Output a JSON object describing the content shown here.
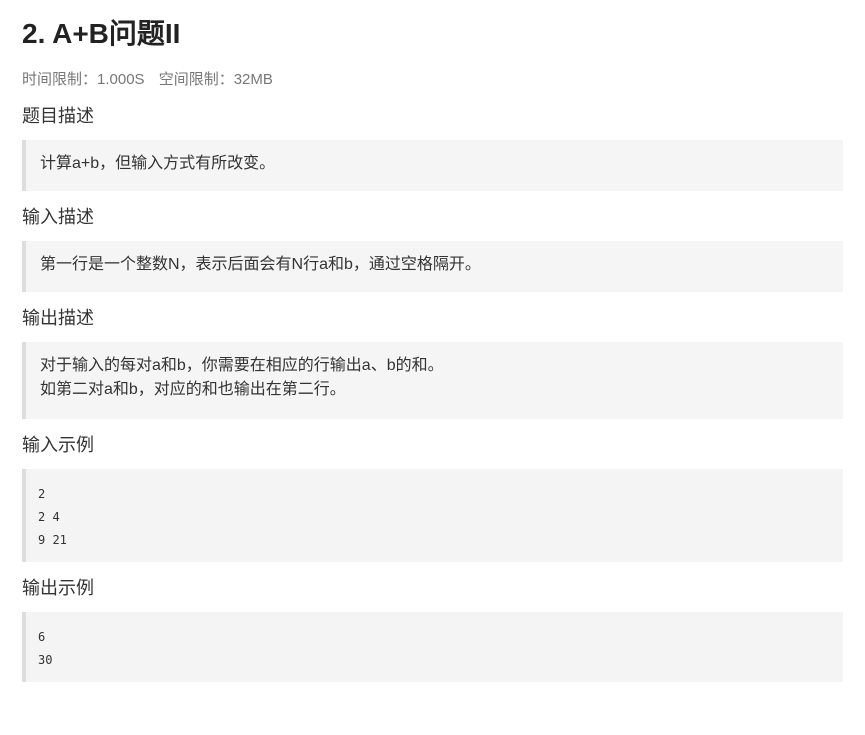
{
  "problem": {
    "title": "2. A+B问题II",
    "time_limit": "时间限制：1.000S",
    "memory_limit": "空间限制：32MB"
  },
  "sections": {
    "description": {
      "heading": "题目描述",
      "lines": [
        "计算a+b，但输入方式有所改变。"
      ]
    },
    "input": {
      "heading": "输入描述",
      "lines": [
        "第一行是一个整数N，表示后面会有N行a和b，通过空格隔开。"
      ]
    },
    "output": {
      "heading": "输出描述",
      "lines": [
        "对于输入的每对a和b，你需要在相应的行输出a、b的和。",
        "如第二对a和b，对应的和也输出在第二行。"
      ]
    },
    "sample_input": {
      "heading": "输入示例",
      "lines": [
        "2",
        "2 4",
        "9 21"
      ]
    },
    "sample_output": {
      "heading": "输出示例",
      "lines": [
        "6",
        "30"
      ]
    }
  }
}
